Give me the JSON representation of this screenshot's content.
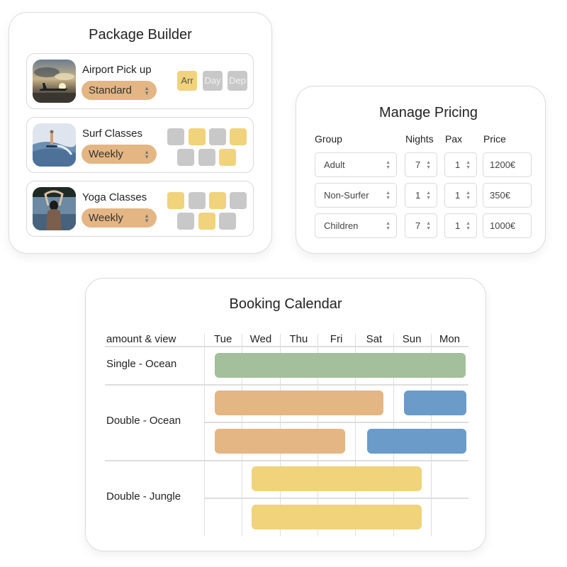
{
  "package_builder": {
    "title": "Package Builder",
    "items": [
      {
        "name": "Airport Pick up",
        "image": "airplane-sunset-photo",
        "option": "Standard",
        "days": [
          {
            "label": "Arr",
            "selected": true
          },
          {
            "label": "Day",
            "selected": false
          },
          {
            "label": "Dep",
            "selected": false
          }
        ]
      },
      {
        "name": "Surf Classes",
        "image": "surfer-wave-photo",
        "option": "Weekly",
        "slots": [
          false,
          true,
          false,
          true,
          false,
          false,
          true
        ]
      },
      {
        "name": "Yoga Classes",
        "image": "yoga-water-photo",
        "option": "Weekly",
        "slots": [
          true,
          false,
          true,
          false,
          false,
          true,
          false
        ]
      }
    ]
  },
  "pricing": {
    "title": "Manage Pricing",
    "columns": [
      "Group",
      "Nights",
      "Pax",
      "Price"
    ],
    "rows": [
      {
        "group": "Adult",
        "nights": "7",
        "pax": "1",
        "price": "1200€"
      },
      {
        "group": "Non-Surfer",
        "nights": "1",
        "pax": "1",
        "price": "350€"
      },
      {
        "group": "Children",
        "nights": "7",
        "pax": "1",
        "price": "1000€"
      }
    ]
  },
  "calendar": {
    "title": "Booking Calendar",
    "corner_label": "amount & view",
    "days": [
      "Tue",
      "Wed",
      "Thu",
      "Fri",
      "Sat",
      "Sun",
      "Mon"
    ],
    "rooms": [
      {
        "label": "Single - Ocean",
        "lanes": [
          [
            {
              "start": 0.28,
              "end": 6.92,
              "color": "#a3bf9b"
            }
          ]
        ]
      },
      {
        "label": "Double - Ocean",
        "lanes": [
          [
            {
              "start": 0.28,
              "end": 4.75,
              "color": "#e3b684"
            },
            {
              "start": 5.3,
              "end": 6.94,
              "color": "#6b9bc8"
            }
          ],
          [
            {
              "start": 0.28,
              "end": 3.73,
              "color": "#e3b684"
            },
            {
              "start": 4.31,
              "end": 6.94,
              "color": "#6b9bc8"
            }
          ]
        ]
      },
      {
        "label": "Double - Jungle",
        "lanes": [
          [
            {
              "start": 1.26,
              "end": 5.76,
              "color": "#f0d37b"
            }
          ],
          [
            {
              "start": 1.26,
              "end": 5.76,
              "color": "#f0d37b"
            }
          ]
        ]
      }
    ]
  },
  "colors": {
    "selected": "#f0d37b",
    "unselected": "#c8c8c8",
    "pill": "#e3b684"
  }
}
